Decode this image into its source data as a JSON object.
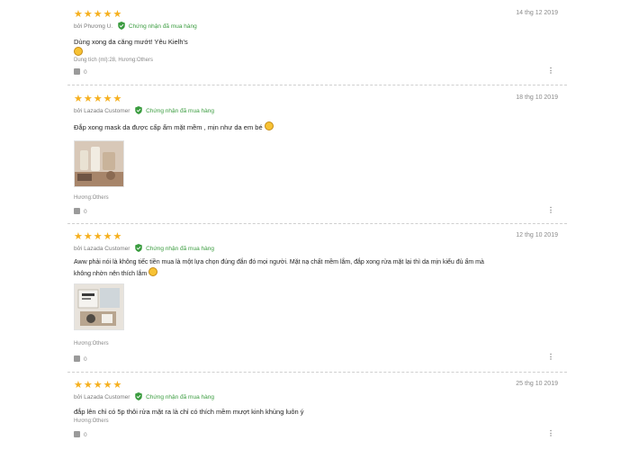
{
  "colors": {
    "star": "#f6b01e",
    "verified": "#3a9c3f",
    "text": "#1f1f1f",
    "muted": "#7a7a7a"
  },
  "reviews": [
    {
      "stars": "★★★★★",
      "author": "bởi Phương U.",
      "verified_label": "Chứng nhận đã mua hàng",
      "date": "14 thg 12 2019",
      "text_line1": "Dùng xong da căng mướt! Yêu Kielh's",
      "text_line2": "",
      "variant": "Dung tích (ml):28, Hương:Others",
      "likes": "0"
    },
    {
      "stars": "★★★★★",
      "author": "bởi Lazada Customer",
      "verified_label": "Chứng nhận đã mua hàng",
      "date": "18 thg 10 2019",
      "text_line1": "Đắp xong mask da được cấp ẩm mặt mềm , mịn như da em bé",
      "text_line2": "",
      "variant": "Hương:Others",
      "likes": "0"
    },
    {
      "stars": "★★★★★",
      "author": "bởi Lazada Customer",
      "verified_label": "Chứng nhận đã mua hàng",
      "date": "12 thg 10 2019",
      "text_line1": "Aww phải nói là không tiếc tiền mua là một lựa chọn đúng đắn đó mọi người. Mặt nạ chất mềm lắm, đắp xong rửa mặt lại thì da mịn kiểu đủ ẩm mà",
      "text_line2": "không nhờn nên thích lắm",
      "variant": "Hương:Others",
      "likes": "0"
    },
    {
      "stars": "★★★★★",
      "author": "bởi Lazada Customer",
      "verified_label": "Chứng nhận đã mua hàng",
      "date": "25 thg 10 2019",
      "text_line1": "đắp lên chỉ có 5p thôi rửa mặt ra là chỉ có thích mềm mượt kinh khủng luôn ý",
      "text_line2": "",
      "variant": "Hương:Others",
      "likes": "0"
    }
  ]
}
